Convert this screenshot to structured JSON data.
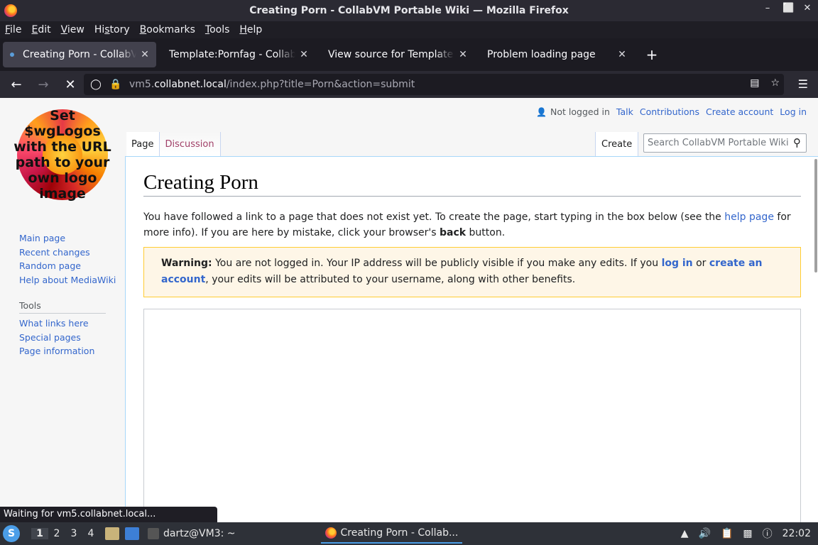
{
  "window": {
    "title": "Creating Porn - CollabVM Portable Wiki — Mozilla Firefox",
    "controls": [
      "–",
      "⬜",
      "✕"
    ]
  },
  "menubar": {
    "items": [
      {
        "label": "File",
        "key": "F",
        "rest": "ile"
      },
      {
        "label": "Edit",
        "key": "E",
        "rest": "dit"
      },
      {
        "label": "View",
        "key": "V",
        "rest": "iew"
      },
      {
        "label": "History",
        "pre": "Hi",
        "key": "s",
        "rest": "tory"
      },
      {
        "label": "Bookmarks",
        "key": "B",
        "rest": "ookmarks"
      },
      {
        "label": "Tools",
        "key": "T",
        "rest": "ools"
      },
      {
        "label": "Help",
        "key": "H",
        "rest": "elp"
      }
    ]
  },
  "tabs": [
    {
      "label": "Creating Porn - CollabVM Portable Wiki",
      "close": "✕"
    },
    {
      "label": "Template:Pornfag - CollabVM Portable Wiki",
      "close": "✕"
    },
    {
      "label": "View source for Template:Porn",
      "close": "✕"
    },
    {
      "label": "Problem loading page",
      "close": "✕"
    }
  ],
  "newtab": "+",
  "nav": {
    "url_host_prefix": "vm5.",
    "url_host": "collabnet.local",
    "url_path": "/index.php?title=Porn&action=submit"
  },
  "logo": {
    "text_lines": [
      "Set",
      "$wgLogos",
      "with the URL",
      "path to your",
      "own logo",
      "image"
    ]
  },
  "sidebar": {
    "nav_links": [
      "Main page",
      "Recent changes",
      "Random page",
      "Help about MediaWiki"
    ],
    "tools_heading": "Tools",
    "tools_links": [
      "What links here",
      "Special pages",
      "Page information"
    ]
  },
  "userbar": {
    "not_logged_in": "Not logged in",
    "links": [
      "Talk",
      "Contributions",
      "Create account",
      "Log in"
    ]
  },
  "page_tabs": {
    "page": "Page",
    "discussion": "Discussion",
    "create": "Create"
  },
  "search": {
    "placeholder": "Search CollabVM Portable Wiki"
  },
  "content": {
    "heading": "Creating Porn",
    "intro_before": "You have followed a link to a page that does not exist yet. To create the page, start typing in the box below (see the ",
    "intro_link": "help page",
    "intro_mid": " for more info). If you are here by mistake, click your browser's ",
    "intro_bold": "back",
    "intro_after": " button.",
    "warn_label": "Warning:",
    "warn_before": " You are not logged in. Your IP address will be publicly visible if you make any edits. If you ",
    "warn_link1": "log in",
    "warn_mid": " or ",
    "warn_link2": "create an account",
    "warn_after": ", your edits will be attributed to your username, along with other benefits."
  },
  "status_text": "Waiting for vm5.collabnet.local...",
  "taskbar": {
    "workspaces": [
      "1",
      "2",
      "3",
      "4"
    ],
    "tasks": [
      {
        "label": "dartz@VM3: ~"
      },
      {
        "label": "Creating Porn - Collab..."
      }
    ],
    "clock": "22:02"
  }
}
